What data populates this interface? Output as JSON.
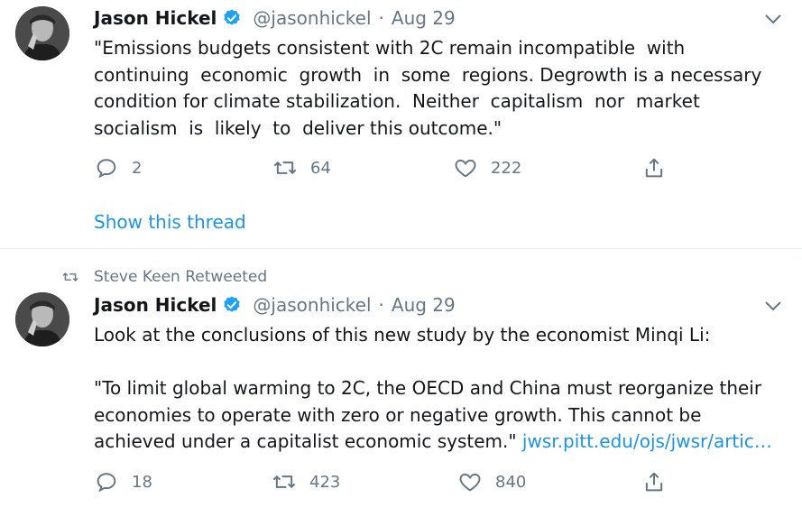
{
  "colors": {
    "accent": "#1b95e0",
    "muted": "#657786",
    "text": "#14171a",
    "verified": "#1da1f2"
  },
  "tweets": [
    {
      "author": "Jason Hickel",
      "handle": "@jasonhickel",
      "separator": "·",
      "date": "Aug 29",
      "text": "\"Emissions budgets consistent with 2C remain incompatible  with\ncontinuing  economic  growth  in  some  regions. Degrowth is a necessary\ncondition for climate stabilization.  Neither  capitalism  nor  market\nsocialism  is  likely  to  deliver this outcome.\"",
      "replies": "2",
      "retweets": "64",
      "likes": "222",
      "show_thread": "Show this thread"
    },
    {
      "retweeted_by": "Steve Keen Retweeted",
      "author": "Jason Hickel",
      "handle": "@jasonhickel",
      "separator": "·",
      "date": "Aug 29",
      "text": "Look at the conclusions of this new study by the economist Minqi Li:\n\n\"To limit global warming to 2C, the OECD and China must reorganize their\neconomies to operate with zero or negative growth. This cannot be\nachieved under a capitalist economic system.\" ",
      "link": "jwsr.pitt.edu/ojs/jwsr/artic…",
      "replies": "18",
      "retweets": "423",
      "likes": "840"
    }
  ]
}
